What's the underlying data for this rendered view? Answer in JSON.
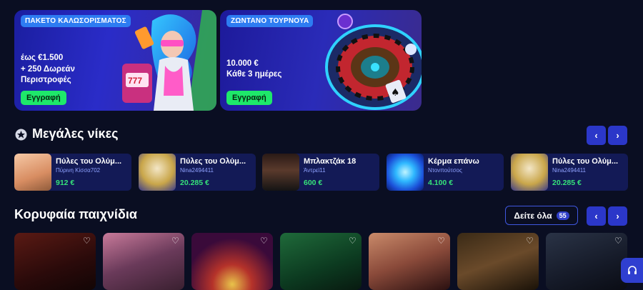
{
  "banners": [
    {
      "tag": "ΠΑΚΕΤΟ ΚΑΛΩΣΟΡΙΣΜΑΤΟΣ",
      "line1": "έως €1.500",
      "line2": "+ 250 Δωρεάν",
      "line3": "Περιστροφές",
      "cta": "Εγγραφή"
    },
    {
      "tag": "ΖΩΝΤΑΝΟ ΤΟΥΡΝΟΥΑ",
      "line1": "10.000 €",
      "line2": "Κάθε 3 ημέρες",
      "cta": "Εγγραφή"
    }
  ],
  "big_wins": {
    "title": "Μεγάλες νίκες",
    "items": [
      {
        "game": "Πύλες του Ολύμ...",
        "user": "Πύρινη Κίσσα702",
        "amount": "912 €"
      },
      {
        "game": "Πύλες του Ολύμ...",
        "user": "Nina2494411",
        "amount": "20.285 €"
      },
      {
        "game": "Μπλακτζάκ 18",
        "user": "Άντρεϊ11",
        "amount": "600 €"
      },
      {
        "game": "Κέρμα επάνω",
        "user": "Ντονπούτσος",
        "amount": "4.100 €"
      },
      {
        "game": "Πύλες του Ολύμ...",
        "user": "Nina2494411",
        "amount": "20.285 €"
      }
    ]
  },
  "top_games": {
    "title": "Κορυφαία παιχνίδια",
    "see_all": "Δείτε όλα",
    "count": "55"
  },
  "icons": {
    "prev": "chevron-left-icon",
    "next": "chevron-right-icon",
    "heart": "heart-icon",
    "support": "headset-icon",
    "trophy": "star-badge-icon"
  },
  "colors": {
    "background": "#0a0e22",
    "accent": "#2b37c9",
    "cta": "#1ee86a",
    "amount": "#36e27a"
  }
}
